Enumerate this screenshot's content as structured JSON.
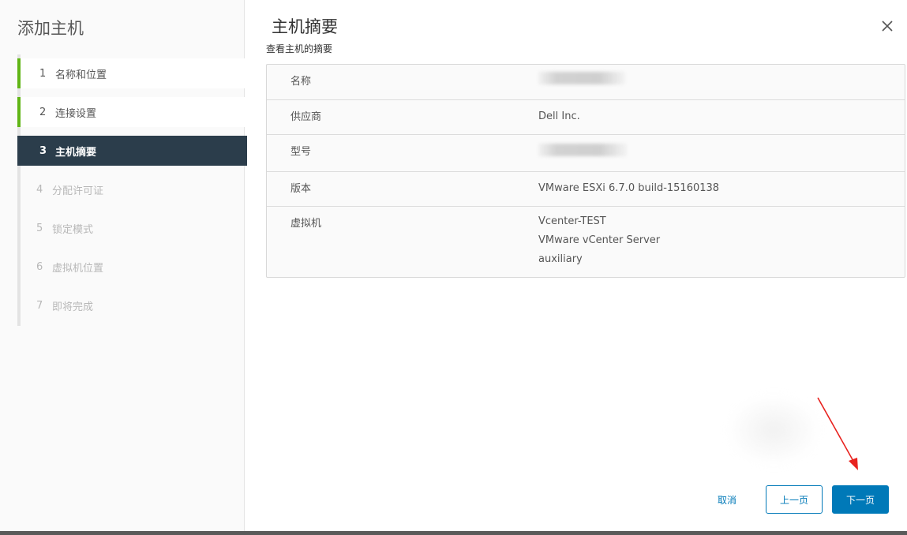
{
  "wizard": {
    "title": "添加主机",
    "steps": [
      {
        "num": "1",
        "label": "名称和位置",
        "state": "done"
      },
      {
        "num": "2",
        "label": "连接设置",
        "state": "done"
      },
      {
        "num": "3",
        "label": "主机摘要",
        "state": "active"
      },
      {
        "num": "4",
        "label": "分配许可证",
        "state": "pending"
      },
      {
        "num": "5",
        "label": "锁定模式",
        "state": "pending"
      },
      {
        "num": "6",
        "label": "虚拟机位置",
        "state": "pending"
      },
      {
        "num": "7",
        "label": "即将完成",
        "state": "pending"
      }
    ]
  },
  "page": {
    "title": "主机摘要",
    "subtitle": "查看主机的摘要"
  },
  "summary": {
    "rows": [
      {
        "label": "名称",
        "value": ""
      },
      {
        "label": "供应商",
        "value": "Dell Inc."
      },
      {
        "label": "型号",
        "value": ""
      },
      {
        "label": "版本",
        "value": "VMware ESXi 6.7.0 build-15160138"
      },
      {
        "label": "虚拟机",
        "values": [
          "Vcenter-TEST",
          "VMware vCenter Server",
          "auxiliary"
        ]
      }
    ]
  },
  "footer": {
    "cancel_label": "取消",
    "prev_label": "上一页",
    "next_label": "下一页"
  },
  "colors": {
    "accent": "#0079b8",
    "active_step_bg": "#2b3d4b",
    "done_step_bar": "#60b515",
    "annotation_arrow": "#e8231f"
  }
}
